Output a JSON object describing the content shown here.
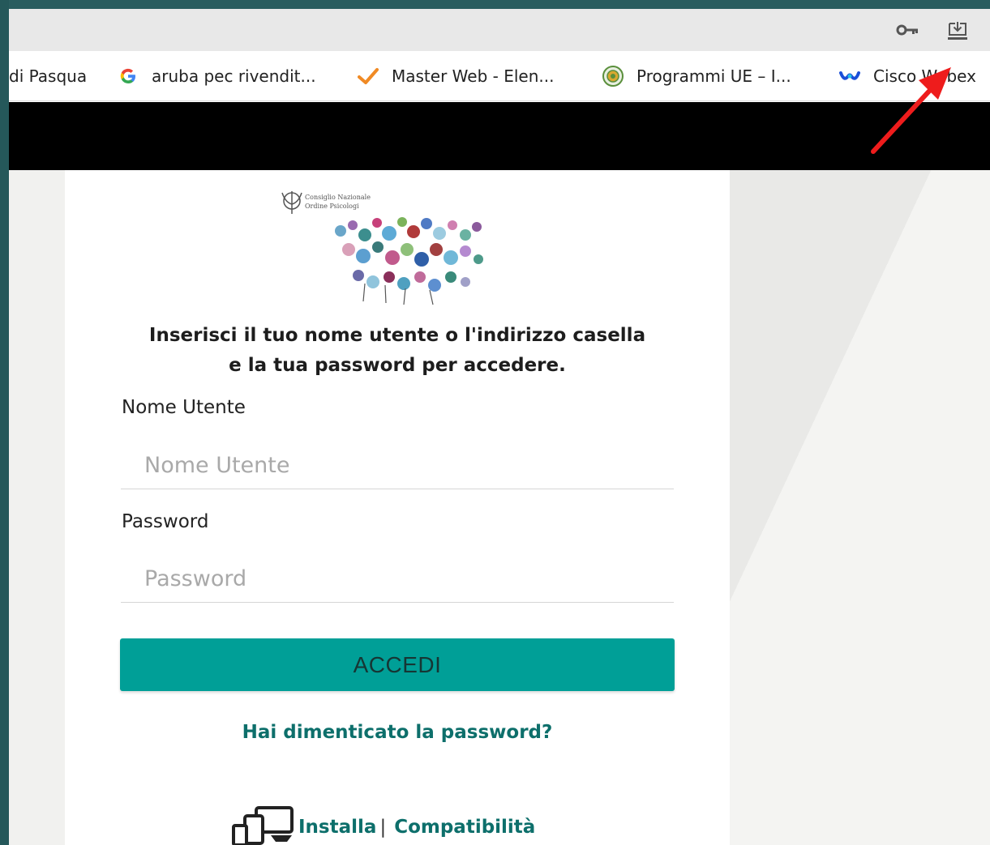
{
  "bookmarks": [
    {
      "label": "di Pasqua",
      "icon": "none"
    },
    {
      "label": "aruba pec rivendit...",
      "icon": "google-icon"
    },
    {
      "label": "Master Web - Elen...",
      "icon": "checkmark-icon"
    },
    {
      "label": "Programmi UE – I...",
      "icon": "eu-seal-icon"
    },
    {
      "label": "Cisco Webex",
      "icon": "webex-icon"
    }
  ],
  "logo": {
    "text": "Consiglio Nazionale Ordine Psicologi"
  },
  "login": {
    "intro_line1": "Inserisci il tuo nome utente o l'indirizzo casella",
    "intro_line2": "e la tua password per accedere.",
    "username_label": "Nome Utente",
    "username_placeholder": "Nome Utente",
    "password_label": "Password",
    "password_placeholder": "Password",
    "submit_label": "ACCEDI",
    "forgot_label": "Hai dimenticato la password?",
    "install_label": "Installa",
    "separator": "|",
    "compat_label": "Compatibilità"
  },
  "colors": {
    "accent": "#009f97",
    "link": "#0d6f6b",
    "annotation_arrow": "#ee1c1c"
  }
}
